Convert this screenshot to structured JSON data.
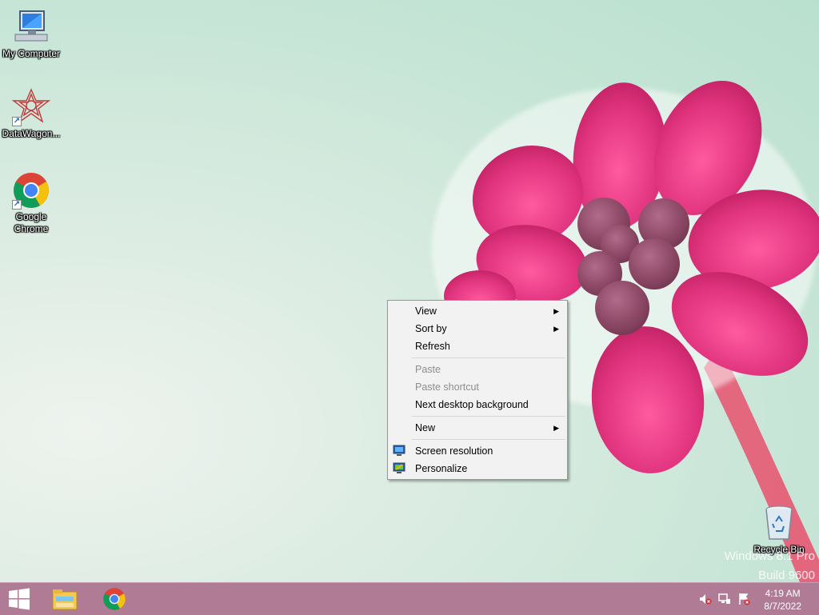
{
  "desktop": {
    "icons": [
      {
        "label": "My Computer"
      },
      {
        "label": "DataWagon..."
      },
      {
        "label": "Google Chrome"
      },
      {
        "label": "Recycle Bin"
      }
    ],
    "watermark": {
      "line1": "Windows 8.1 Pro",
      "line2": "Build 9600"
    }
  },
  "context_menu": {
    "items": [
      {
        "label": "View",
        "submenu": true,
        "enabled": true
      },
      {
        "label": "Sort by",
        "submenu": true,
        "enabled": true
      },
      {
        "label": "Refresh",
        "enabled": true
      },
      {
        "label": "Paste",
        "enabled": false
      },
      {
        "label": "Paste shortcut",
        "enabled": false
      },
      {
        "label": "Next desktop background",
        "enabled": true
      },
      {
        "label": "New",
        "submenu": true,
        "enabled": true
      },
      {
        "label": "Screen resolution",
        "icon": "display-icon",
        "enabled": true
      },
      {
        "label": "Personalize",
        "icon": "personalize-icon",
        "enabled": true
      }
    ]
  },
  "taskbar": {
    "start": "windows-logo-icon",
    "pinned": [
      "file-explorer-icon",
      "chrome-icon"
    ],
    "tray": [
      "volume-muted-icon",
      "network-icon",
      "action-center-icon"
    ],
    "clock": {
      "time": "4:19 AM",
      "date": "8/7/2022"
    }
  },
  "colors": {
    "taskbar": "#b07c95",
    "menu_bg": "#f2f2f2",
    "flower": "#e0347e"
  }
}
